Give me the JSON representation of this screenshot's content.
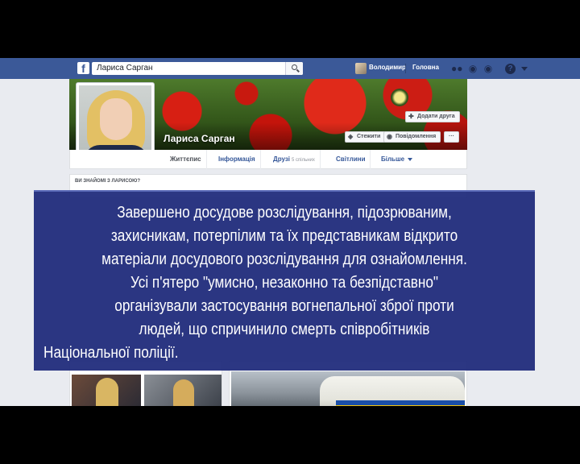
{
  "topbar": {
    "logo": "f",
    "search_value": "Лариса Сарган",
    "user_name": "Володимир",
    "home_label": "Головна",
    "icons": [
      "search-icon",
      "friends-icon",
      "messages-icon",
      "globe-icon",
      "help-icon",
      "chevron-down-icon"
    ],
    "brand_color": "#3b5998"
  },
  "profile": {
    "name": "Лариса Сарган",
    "add_friend_label": "Додати друга",
    "follow_label": "Стежити",
    "message_label": "Повідомлення",
    "more_label": "···"
  },
  "tabs": {
    "timeline": "Життєпис",
    "info": "Інформація",
    "friends": "Друзі",
    "friends_count": "5 спільних",
    "photos": "Світлини",
    "more": "Більше"
  },
  "know_card": {
    "label": "ВИ ЗНАЙОМІ З ЛАРИСОЮ?"
  },
  "caption": {
    "lines": [
      "Завершено досудове розслідування, підозрюваним,",
      "захисникам, потерпілим та їх представникам відкрито",
      "матеріали досудового розслідування для ознайомлення.",
      "Усі п'ятеро \"умисно, незаконно та безпідставно\"",
      "організували застосування вогнепальної зброї проти",
      "людей, що спричинило смерть співробітників",
      "Національної поліції."
    ],
    "background": "#1c287a"
  }
}
